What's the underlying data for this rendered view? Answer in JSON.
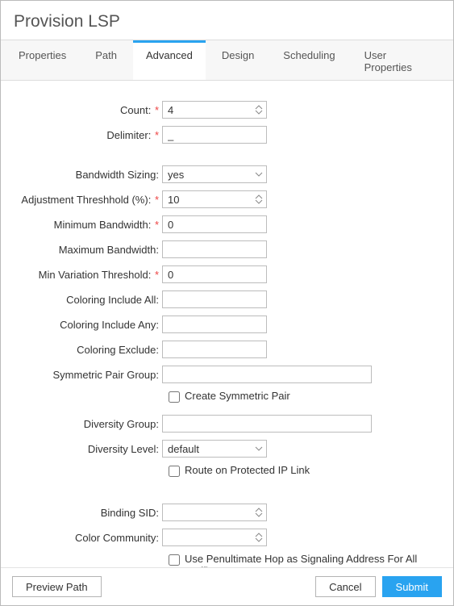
{
  "dialog": {
    "title": "Provision LSP"
  },
  "tabs": {
    "properties": "Properties",
    "path": "Path",
    "advanced": "Advanced",
    "design": "Design",
    "scheduling": "Scheduling",
    "user_properties": "User Properties"
  },
  "labels": {
    "count": "Count:",
    "delimiter": "Delimiter:",
    "bandwidth_sizing": "Bandwidth Sizing:",
    "adj_threshold": "Adjustment Threshhold (%):",
    "min_bw": "Minimum Bandwidth:",
    "max_bw": "Maximum Bandwidth:",
    "min_var": "Min Variation Threshold:",
    "col_incl_all": "Coloring Include All:",
    "col_incl_any": "Coloring Include Any:",
    "col_excl": "Coloring Exclude:",
    "sym_pair_group": "Symmetric Pair Group:",
    "create_sym_pair": "Create Symmetric Pair",
    "div_group": "Diversity Group:",
    "div_level": "Diversity Level:",
    "route_protected": "Route on Protected IP Link",
    "binding_sid": "Binding SID:",
    "color_community": "Color Community:",
    "use_penult": "Use Penultimate Hop as Signaling Address For All Traffic"
  },
  "values": {
    "count": "4",
    "delimiter": "_",
    "bandwidth_sizing": "yes",
    "adj_threshold": "10",
    "min_bw": "0",
    "max_bw": "",
    "min_var": "0",
    "col_incl_all": "",
    "col_incl_any": "",
    "col_excl": "",
    "sym_pair_group": "",
    "div_group": "",
    "div_level": "default",
    "binding_sid": "",
    "color_community": ""
  },
  "footer": {
    "preview": "Preview Path",
    "cancel": "Cancel",
    "submit": "Submit"
  }
}
